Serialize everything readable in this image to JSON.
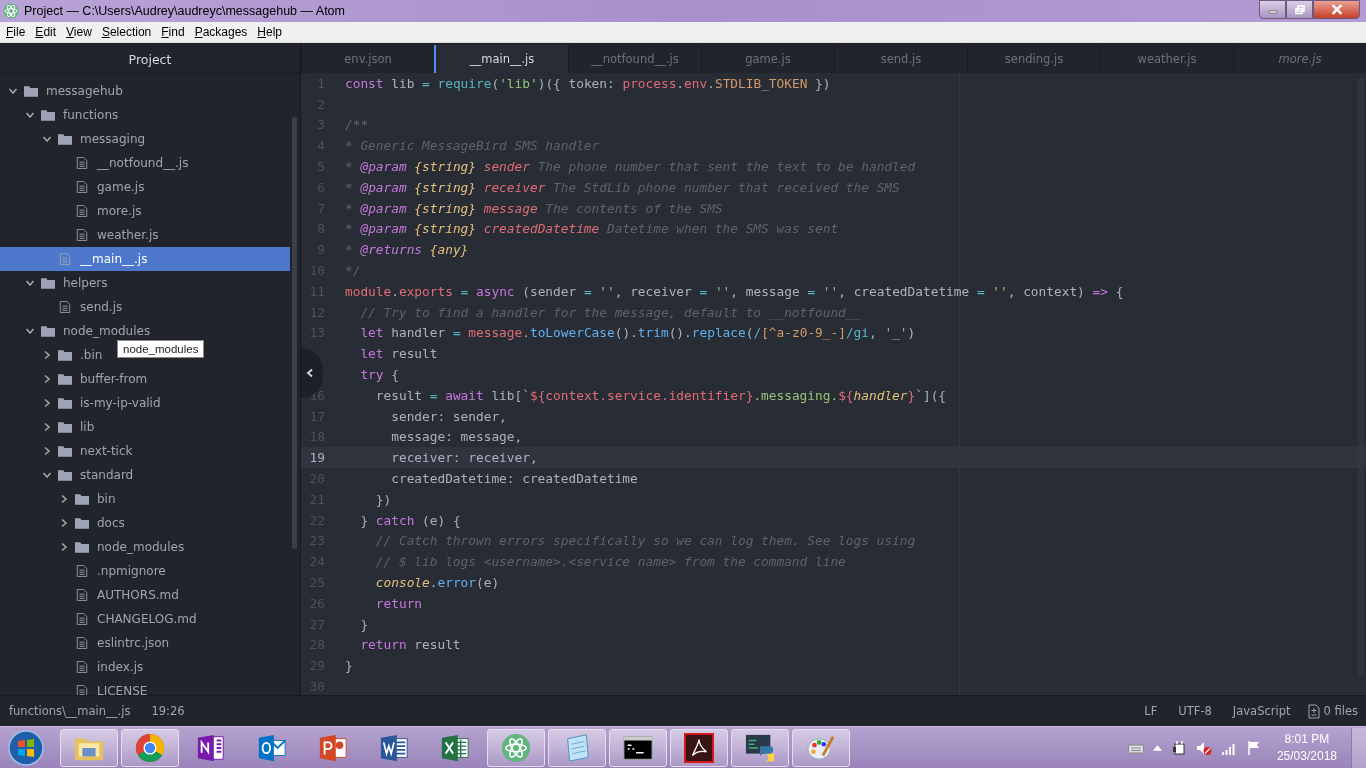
{
  "window": {
    "title": "Project — C:\\Users\\Audrey\\audreyc\\messagehub — Atom"
  },
  "menu": [
    "File",
    "Edit",
    "View",
    "Selection",
    "Find",
    "Packages",
    "Help"
  ],
  "sidebar": {
    "title": "Project",
    "tooltip": "node_modules",
    "tree": [
      {
        "name": "messagehub",
        "kind": "folder",
        "expanded": true,
        "selected": false,
        "children": [
          {
            "name": "functions",
            "kind": "folder",
            "expanded": true,
            "selected": false,
            "children": [
              {
                "name": "messaging",
                "kind": "folder",
                "expanded": true,
                "selected": false,
                "children": [
                  {
                    "name": "__notfound__.js",
                    "kind": "file",
                    "selected": false
                  },
                  {
                    "name": "game.js",
                    "kind": "file",
                    "selected": false
                  },
                  {
                    "name": "more.js",
                    "kind": "file",
                    "selected": false
                  },
                  {
                    "name": "weather.js",
                    "kind": "file",
                    "selected": false
                  }
                ]
              },
              {
                "name": "__main__.js",
                "kind": "file",
                "selected": true
              }
            ]
          },
          {
            "name": "helpers",
            "kind": "folder",
            "expanded": true,
            "selected": false,
            "children": [
              {
                "name": "send.js",
                "kind": "file",
                "selected": false
              }
            ]
          },
          {
            "name": "node_modules",
            "kind": "folder",
            "expanded": true,
            "selected": false,
            "children": [
              {
                "name": ".bin",
                "kind": "folder",
                "expanded": false,
                "selected": false
              },
              {
                "name": "buffer-from",
                "kind": "folder",
                "expanded": false,
                "selected": false
              },
              {
                "name": "is-my-ip-valid",
                "kind": "folder",
                "expanded": false,
                "selected": false
              },
              {
                "name": "lib",
                "kind": "folder",
                "expanded": false,
                "selected": false
              },
              {
                "name": "next-tick",
                "kind": "folder",
                "expanded": false,
                "selected": false
              },
              {
                "name": "standard",
                "kind": "folder",
                "expanded": true,
                "selected": false,
                "children": [
                  {
                    "name": "bin",
                    "kind": "folder",
                    "expanded": false,
                    "selected": false
                  },
                  {
                    "name": "docs",
                    "kind": "folder",
                    "expanded": false,
                    "selected": false
                  },
                  {
                    "name": "node_modules",
                    "kind": "folder",
                    "expanded": false,
                    "selected": false
                  },
                  {
                    "name": ".npmignore",
                    "kind": "file",
                    "selected": false
                  },
                  {
                    "name": "AUTHORS.md",
                    "kind": "file",
                    "selected": false
                  },
                  {
                    "name": "CHANGELOG.md",
                    "kind": "file",
                    "selected": false
                  },
                  {
                    "name": "eslintrc.json",
                    "kind": "file",
                    "selected": false
                  },
                  {
                    "name": "index.js",
                    "kind": "file",
                    "selected": false
                  },
                  {
                    "name": "LICENSE",
                    "kind": "file",
                    "selected": false
                  }
                ]
              }
            ]
          }
        ]
      }
    ]
  },
  "tabs": [
    {
      "label": "env.json",
      "selected": false,
      "pending": false
    },
    {
      "label": "__main__.js",
      "selected": true,
      "pending": false
    },
    {
      "label": "__notfound__.js",
      "selected": false,
      "pending": false
    },
    {
      "label": "game.js",
      "selected": false,
      "pending": false
    },
    {
      "label": "send.js",
      "selected": false,
      "pending": false
    },
    {
      "label": "sending.js",
      "selected": false,
      "pending": false
    },
    {
      "label": "weather.js",
      "selected": false,
      "pending": false
    },
    {
      "label": "more.js",
      "selected": false,
      "pending": true
    }
  ],
  "editor": {
    "lines": [
      {
        "number": "1",
        "current": false,
        "tokens": [
          {
            "kind": "kw",
            "text": "const"
          },
          {
            "kind": "pl",
            "text": " lib "
          },
          {
            "kind": "op",
            "text": "="
          },
          {
            "kind": "bi",
            "text": " require"
          },
          {
            "kind": "pl",
            "text": "("
          },
          {
            "kind": "str",
            "text": "'lib'"
          },
          {
            "kind": "pl",
            "text": ")({ token: "
          },
          {
            "kind": "var",
            "text": "process"
          },
          {
            "kind": "pl",
            "text": "."
          },
          {
            "kind": "var",
            "text": "env"
          },
          {
            "kind": "pl",
            "text": "."
          },
          {
            "kind": "num",
            "text": "STDLIB_TOKEN"
          },
          {
            "kind": "pl",
            "text": " })"
          }
        ]
      },
      {
        "number": "2",
        "current": false
      },
      {
        "number": "3",
        "current": false,
        "tokens": [
          {
            "kind": "cm",
            "text": "/**"
          }
        ]
      },
      {
        "number": "4",
        "current": false,
        "tokens": [
          {
            "kind": "cm",
            "text": "* Generic MessageBird SMS handler"
          }
        ]
      },
      {
        "number": "5",
        "current": false,
        "tokens": [
          {
            "kind": "cm",
            "text": "* "
          },
          {
            "kind": "tag",
            "text": "@param"
          },
          {
            "kind": "ty",
            "text": " {string}"
          },
          {
            "kind": "param",
            "text": " sender"
          },
          {
            "kind": "cm",
            "text": " The phone number that sent the text to be handled"
          }
        ]
      },
      {
        "number": "6",
        "current": false,
        "tokens": [
          {
            "kind": "cm",
            "text": "* "
          },
          {
            "kind": "tag",
            "text": "@param"
          },
          {
            "kind": "ty",
            "text": " {string}"
          },
          {
            "kind": "param",
            "text": " receiver"
          },
          {
            "kind": "cm",
            "text": " The StdLib phone number that received the SMS"
          }
        ]
      },
      {
        "number": "7",
        "current": false,
        "tokens": [
          {
            "kind": "cm",
            "text": "* "
          },
          {
            "kind": "tag",
            "text": "@param"
          },
          {
            "kind": "ty",
            "text": " {string}"
          },
          {
            "kind": "param",
            "text": " message"
          },
          {
            "kind": "cm",
            "text": " The contents of the SMS"
          }
        ]
      },
      {
        "number": "8",
        "current": false,
        "tokens": [
          {
            "kind": "cm",
            "text": "* "
          },
          {
            "kind": "tag",
            "text": "@param"
          },
          {
            "kind": "ty",
            "text": " {string}"
          },
          {
            "kind": "param",
            "text": " createdDatetime"
          },
          {
            "kind": "cm",
            "text": " Datetime when the SMS was sent"
          }
        ]
      },
      {
        "number": "9",
        "current": false,
        "tokens": [
          {
            "kind": "cm",
            "text": "* "
          },
          {
            "kind": "tag",
            "text": "@returns"
          },
          {
            "kind": "ty",
            "text": " {any}"
          }
        ]
      },
      {
        "number": "10",
        "current": false,
        "tokens": [
          {
            "kind": "cm",
            "text": "*/"
          }
        ]
      },
      {
        "number": "11",
        "current": false,
        "tokens": [
          {
            "kind": "var",
            "text": "module"
          },
          {
            "kind": "pl",
            "text": "."
          },
          {
            "kind": "var",
            "text": "exports"
          },
          {
            "kind": "op",
            "text": " ="
          },
          {
            "kind": "kw",
            "text": " async"
          },
          {
            "kind": "pl",
            "text": " (sender "
          },
          {
            "kind": "op",
            "text": "="
          },
          {
            "kind": "str",
            "text": " ''"
          },
          {
            "kind": "pl",
            "text": ", receiver "
          },
          {
            "kind": "op",
            "text": "="
          },
          {
            "kind": "str",
            "text": " ''"
          },
          {
            "kind": "pl",
            "text": ", message "
          },
          {
            "kind": "op",
            "text": "="
          },
          {
            "kind": "str",
            "text": " ''"
          },
          {
            "kind": "pl",
            "text": ", createdDatetime "
          },
          {
            "kind": "op",
            "text": "="
          },
          {
            "kind": "str",
            "text": " ''"
          },
          {
            "kind": "pl",
            "text": ", context) "
          },
          {
            "kind": "kw",
            "text": "=>"
          },
          {
            "kind": "pl",
            "text": " {"
          }
        ]
      },
      {
        "number": "12",
        "current": false,
        "tokens": [
          {
            "kind": "cm",
            "text": "  // Try to find a handler for the message, default to __notfound__"
          }
        ]
      },
      {
        "number": "13",
        "current": false,
        "tokens": [
          {
            "kind": "kw",
            "text": "  let"
          },
          {
            "kind": "pl",
            "text": " handler "
          },
          {
            "kind": "op",
            "text": "="
          },
          {
            "kind": "var",
            "text": " message"
          },
          {
            "kind": "pl",
            "text": "."
          },
          {
            "kind": "fn",
            "text": "toLowerCase"
          },
          {
            "kind": "pl",
            "text": "()."
          },
          {
            "kind": "fn",
            "text": "trim"
          },
          {
            "kind": "pl",
            "text": "()."
          },
          {
            "kind": "fn",
            "text": "replace"
          },
          {
            "kind": "pl",
            "text": "("
          },
          {
            "kind": "op",
            "text": "/"
          },
          {
            "kind": "num",
            "text": "[^a-z0-9_-]"
          },
          {
            "kind": "op",
            "text": "/gi"
          },
          {
            "kind": "pl",
            "text": ", "
          },
          {
            "kind": "str",
            "text": "'_'"
          },
          {
            "kind": "pl",
            "text": ")"
          }
        ]
      },
      {
        "tokens": [
          {
            "kind": "kw",
            "text": "  let"
          },
          {
            "kind": "pl",
            "text": " result"
          }
        ]
      },
      {
        "tokens": [
          {
            "kind": "kw",
            "text": "  try"
          },
          {
            "kind": "pl",
            "text": " {"
          }
        ]
      },
      {
        "number": "16",
        "current": false,
        "tokens": [
          {
            "kind": "pl",
            "text": "    result "
          },
          {
            "kind": "op",
            "text": "="
          },
          {
            "kind": "kw",
            "text": " await"
          },
          {
            "kind": "pl",
            "text": " lib["
          },
          {
            "kind": "str",
            "text": "`"
          },
          {
            "kind": "var",
            "text": "${context.service.identifier}"
          },
          {
            "kind": "str",
            "text": ".messaging."
          },
          {
            "kind": "var",
            "text": "${"
          },
          {
            "kind": "ty",
            "text": "handler"
          },
          {
            "kind": "var",
            "text": "}"
          },
          {
            "kind": "str",
            "text": "`"
          },
          {
            "kind": "pl",
            "text": "]({"
          }
        ]
      },
      {
        "number": "17",
        "current": false,
        "tokens": [
          {
            "kind": "pl",
            "text": "      sender: sender,"
          }
        ]
      },
      {
        "number": "18",
        "current": false,
        "tokens": [
          {
            "kind": "pl",
            "text": "      message: message,"
          }
        ]
      },
      {
        "number": "19",
        "current": true,
        "tokens": [
          {
            "kind": "pl",
            "text": "      receiver: receiver,"
          }
        ]
      },
      {
        "number": "20",
        "current": false,
        "tokens": [
          {
            "kind": "pl",
            "text": "      createdDatetime: createdDatetime"
          }
        ]
      },
      {
        "number": "21",
        "current": false,
        "tokens": [
          {
            "kind": "pl",
            "text": "    })"
          }
        ]
      },
      {
        "number": "22",
        "current": false,
        "tokens": [
          {
            "kind": "pl",
            "text": "  } "
          },
          {
            "kind": "kw",
            "text": "catch"
          },
          {
            "kind": "pl",
            "text": " (e) {"
          }
        ]
      },
      {
        "number": "23",
        "current": false,
        "tokens": [
          {
            "kind": "cm",
            "text": "    // Catch thrown errors specifically so we can log them. See logs using"
          }
        ]
      },
      {
        "number": "24",
        "current": false,
        "tokens": [
          {
            "kind": "cm",
            "text": "    // $ lib logs <username>.<service name> from the command line"
          }
        ]
      },
      {
        "number": "25",
        "current": false,
        "tokens": [
          {
            "kind": "ty",
            "text": "    console"
          },
          {
            "kind": "pl",
            "text": "."
          },
          {
            "kind": "fn",
            "text": "error"
          },
          {
            "kind": "pl",
            "text": "(e)"
          }
        ]
      },
      {
        "number": "26",
        "current": false,
        "tokens": [
          {
            "kind": "kw",
            "text": "    return"
          }
        ]
      },
      {
        "number": "27",
        "current": false,
        "tokens": [
          {
            "kind": "pl",
            "text": "  }"
          }
        ]
      },
      {
        "number": "28",
        "current": false,
        "tokens": [
          {
            "kind": "kw",
            "text": "  return"
          },
          {
            "kind": "pl",
            "text": " result"
          }
        ]
      },
      {
        "number": "29",
        "current": false,
        "tokens": [
          {
            "kind": "pl",
            "text": "}"
          }
        ]
      },
      {
        "number": "30",
        "current": false
      }
    ]
  },
  "status_bar": {
    "path": "functions\\__main__.js",
    "cursor": "19:26",
    "line_ending": "LF",
    "encoding": "UTF-8",
    "grammar": "JavaScript",
    "git": "0 files"
  },
  "taskbar": {
    "apps": [
      {
        "kind": "explorer",
        "open": true
      },
      {
        "kind": "chrome",
        "open": true
      },
      {
        "kind": "onenote",
        "open": false
      },
      {
        "kind": "outlook",
        "open": false
      },
      {
        "kind": "powerpoint",
        "open": false
      },
      {
        "kind": "word",
        "open": false
      },
      {
        "kind": "excel",
        "open": false
      },
      {
        "kind": "atom",
        "open": true
      },
      {
        "kind": "notepad",
        "open": true
      },
      {
        "kind": "cmd",
        "open": true
      },
      {
        "kind": "acrobat",
        "open": true
      },
      {
        "kind": "python",
        "open": true
      },
      {
        "kind": "paint",
        "open": true
      }
    ],
    "time": "8:01 PM",
    "date": "25/03/2018"
  }
}
